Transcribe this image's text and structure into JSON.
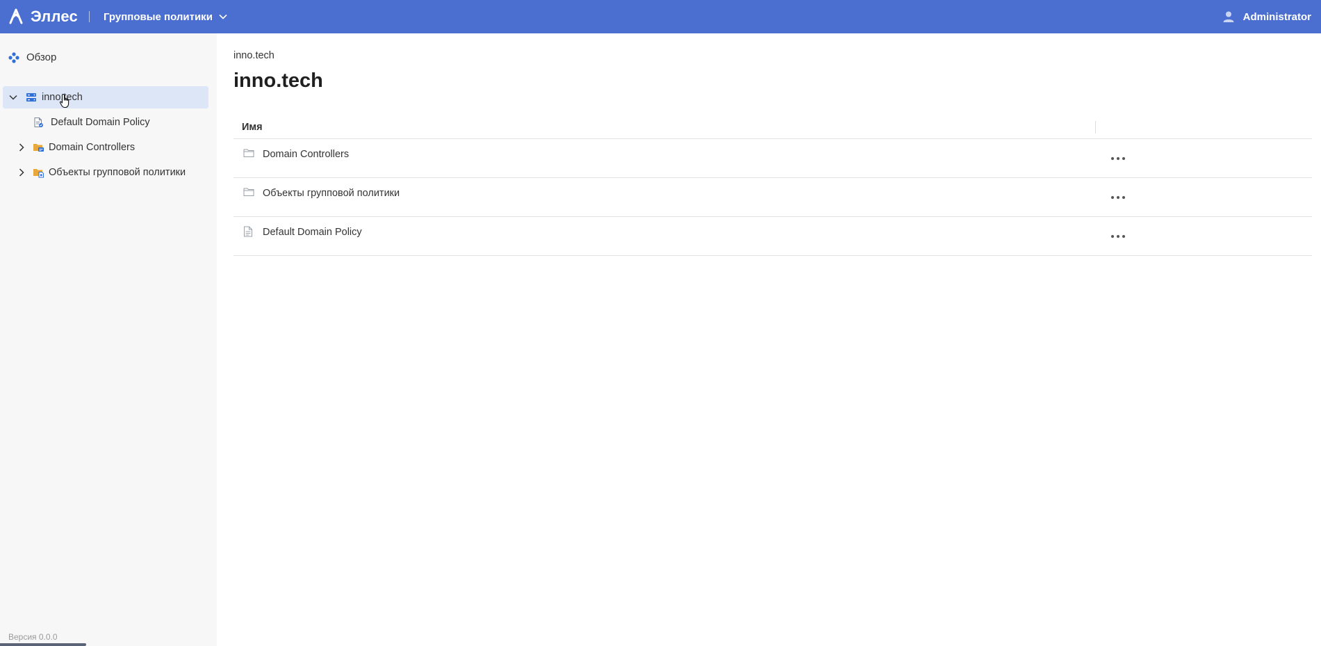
{
  "app": {
    "name": "Эллес",
    "module": "Групповые политики",
    "user": "Administrator",
    "version": "Версия 0.0.0"
  },
  "sidebar": {
    "overview_label": "Обзор",
    "tree": [
      {
        "label": "inno.tech",
        "level": 0,
        "expanded": true,
        "selected": true,
        "icon": "domain-icon"
      },
      {
        "label": "Default Domain Policy",
        "level": 1,
        "expanded": false,
        "selected": false,
        "icon": "policy-icon"
      },
      {
        "label": "Domain Controllers",
        "level": 1,
        "expanded": false,
        "selected": false,
        "icon": "ou-folder-icon"
      },
      {
        "label": "Объекты групповой политики",
        "level": 1,
        "expanded": false,
        "selected": false,
        "icon": "gpo-folder-icon"
      }
    ]
  },
  "main": {
    "breadcrumb": "inno.tech",
    "title": "inno.tech",
    "table": {
      "column_name": "Имя",
      "rows": [
        {
          "name": "Domain Controllers",
          "icon": "folder-icon"
        },
        {
          "name": "Объекты групповой политики",
          "icon": "folder-icon"
        },
        {
          "name": "Default Domain Policy",
          "icon": "document-icon"
        }
      ]
    }
  },
  "colors": {
    "header_bg": "#4a6fd0",
    "sidebar_bg": "#f7f7f7",
    "selected_bg": "#dde6f7",
    "accent": "#2f6fd6",
    "folder": "#e9a83b"
  }
}
